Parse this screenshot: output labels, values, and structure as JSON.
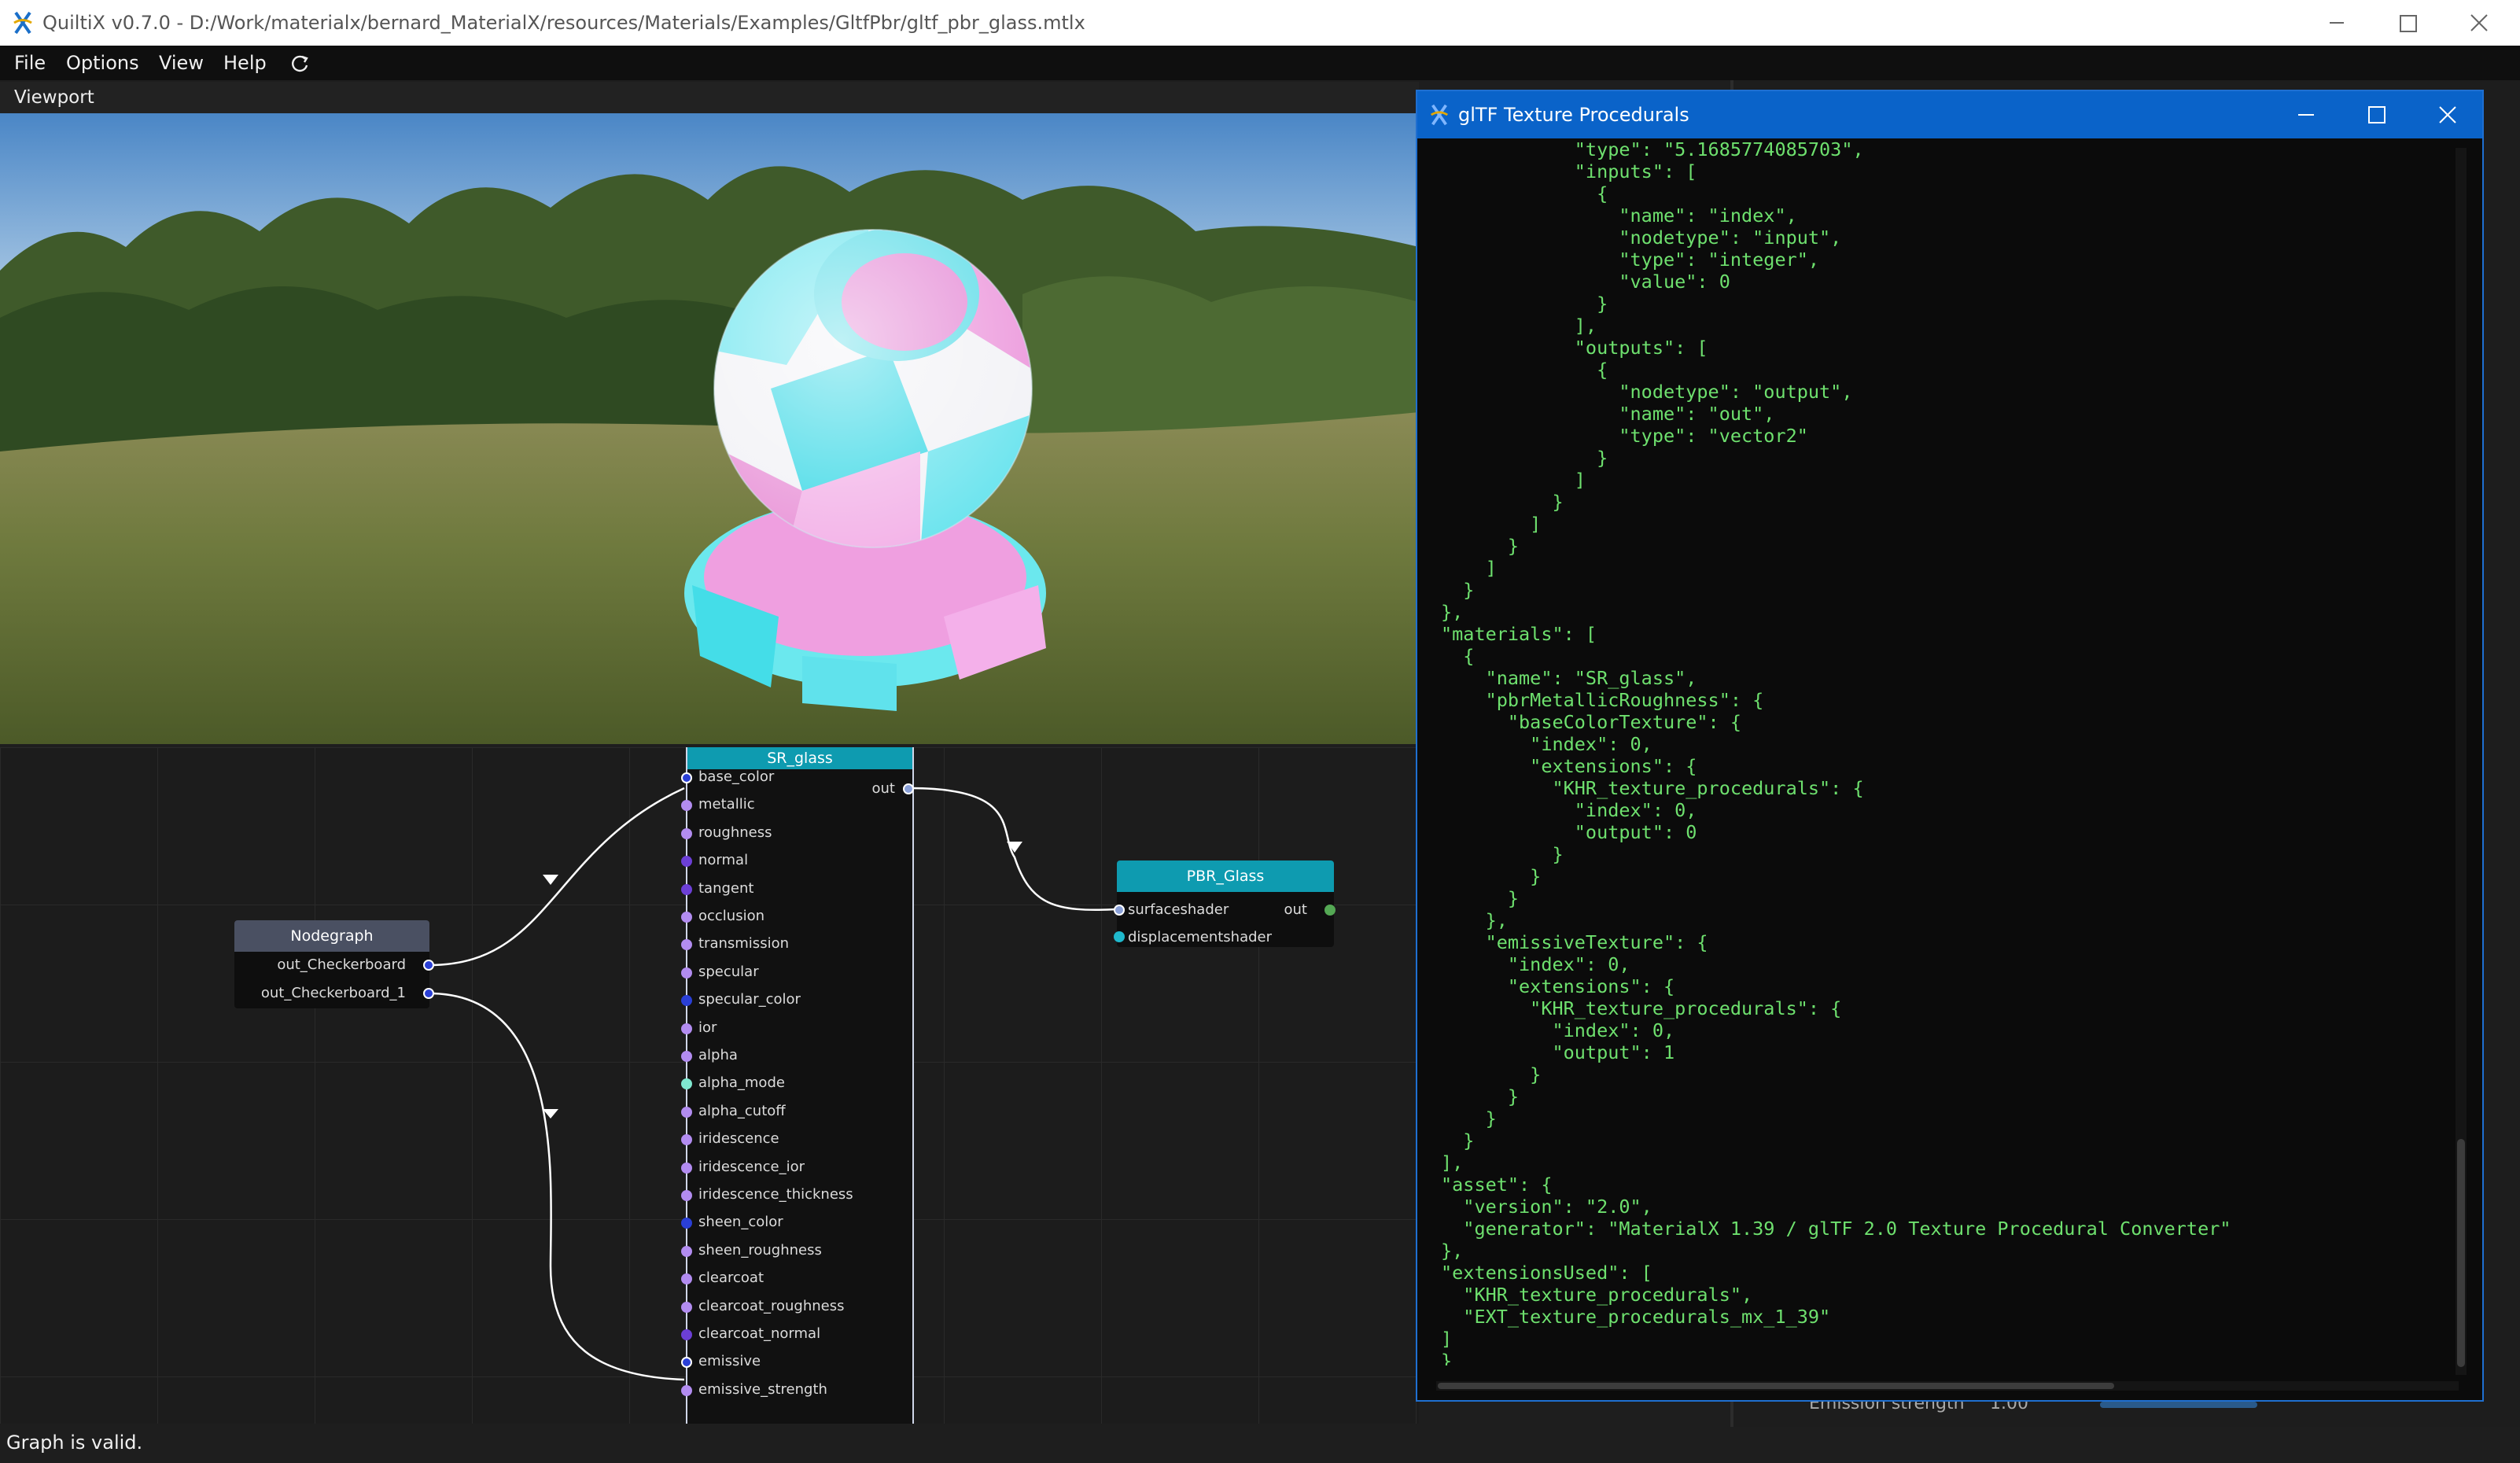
{
  "window": {
    "title": "QuiltiX v0.7.0 - D:/Work/materialx/bernard_MaterialX/resources/Materials/Examples/GltfPbr/gltf_pbr_glass.mtlx",
    "icon": "quiltix-logo-icon"
  },
  "menu": [
    "File",
    "Options",
    "View",
    "Help"
  ],
  "viewport": {
    "label": "Viewport"
  },
  "graph": {
    "nodegraph": {
      "title": "Nodegraph",
      "outputs": [
        "out_Checkerboard",
        "out_Checkerboard_1"
      ]
    },
    "sr_glass": {
      "title": "SR_glass",
      "output": "out",
      "inputs": [
        {
          "label": "base_color",
          "color": "#ffffff"
        },
        {
          "label": "metallic",
          "color": "#b28cf0"
        },
        {
          "label": "roughness",
          "color": "#b28cf0"
        },
        {
          "label": "normal",
          "color": "#6c3fd6"
        },
        {
          "label": "tangent",
          "color": "#6c3fd6"
        },
        {
          "label": "occlusion",
          "color": "#b28cf0"
        },
        {
          "label": "transmission",
          "color": "#b28cf0"
        },
        {
          "label": "specular",
          "color": "#b28cf0"
        },
        {
          "label": "specular_color",
          "color": "#2a3fd6"
        },
        {
          "label": "ior",
          "color": "#b28cf0"
        },
        {
          "label": "alpha",
          "color": "#b28cf0"
        },
        {
          "label": "alpha_mode",
          "color": "#7fe8d0"
        },
        {
          "label": "alpha_cutoff",
          "color": "#b28cf0"
        },
        {
          "label": "iridescence",
          "color": "#b28cf0"
        },
        {
          "label": "iridescence_ior",
          "color": "#b28cf0"
        },
        {
          "label": "iridescence_thickness",
          "color": "#b28cf0"
        },
        {
          "label": "sheen_color",
          "color": "#2a3fd6"
        },
        {
          "label": "sheen_roughness",
          "color": "#b28cf0"
        },
        {
          "label": "clearcoat",
          "color": "#b28cf0"
        },
        {
          "label": "clearcoat_roughness",
          "color": "#b28cf0"
        },
        {
          "label": "clearcoat_normal",
          "color": "#6c3fd6"
        },
        {
          "label": "emissive",
          "color": "#ffffff"
        },
        {
          "label": "emissive_strength",
          "color": "#b28cf0"
        }
      ]
    },
    "pbr_glass": {
      "title": "PBR_Glass",
      "inputs": [
        "surfaceshader",
        "displacementshader"
      ],
      "output": "out"
    }
  },
  "status": {
    "text": "Graph is valid."
  },
  "dialog": {
    "title": "glTF Texture Procedurals",
    "json_lines": [
      "            \"type\": \"5.1685774085703\",",
      "            \"inputs\": [",
      "              {",
      "                \"name\": \"index\",",
      "                \"nodetype\": \"input\",",
      "                \"type\": \"integer\",",
      "                \"value\": 0",
      "              }",
      "            ],",
      "            \"outputs\": [",
      "              {",
      "                \"nodetype\": \"output\",",
      "                \"name\": \"out\",",
      "                \"type\": \"vector2\"",
      "              }",
      "            ]",
      "          }",
      "        ]",
      "      }",
      "    ]",
      "  }",
      "},",
      "\"materials\": [",
      "  {",
      "    \"name\": \"SR_glass\",",
      "    \"pbrMetallicRoughness\": {",
      "      \"baseColorTexture\": {",
      "        \"index\": 0,",
      "        \"extensions\": {",
      "          \"KHR_texture_procedurals\": {",
      "            \"index\": 0,",
      "            \"output\": 0",
      "          }",
      "        }",
      "      }",
      "    },",
      "    \"emissiveTexture\": {",
      "      \"index\": 0,",
      "      \"extensions\": {",
      "        \"KHR_texture_procedurals\": {",
      "          \"index\": 0,",
      "          \"output\": 1",
      "        }",
      "      }",
      "    }",
      "  }",
      "],",
      "\"asset\": {",
      "  \"version\": \"2.0\",",
      "  \"generator\": \"MaterialX 1.39 / glTF 2.0 Texture Procedural Converter\"",
      "},",
      "\"extensionsUsed\": [",
      "  \"KHR_texture_procedurals\",",
      "  \"EXT_texture_procedurals_mx_1_39\"",
      "]"
    ],
    "closing": "}"
  },
  "right_panel": {
    "partial_label": "Emission strength",
    "partial_value": "1.00"
  },
  "colors": {
    "accent": "#0a63c9",
    "node_header": "#0e9bb0",
    "json_text": "#6ee06e"
  }
}
